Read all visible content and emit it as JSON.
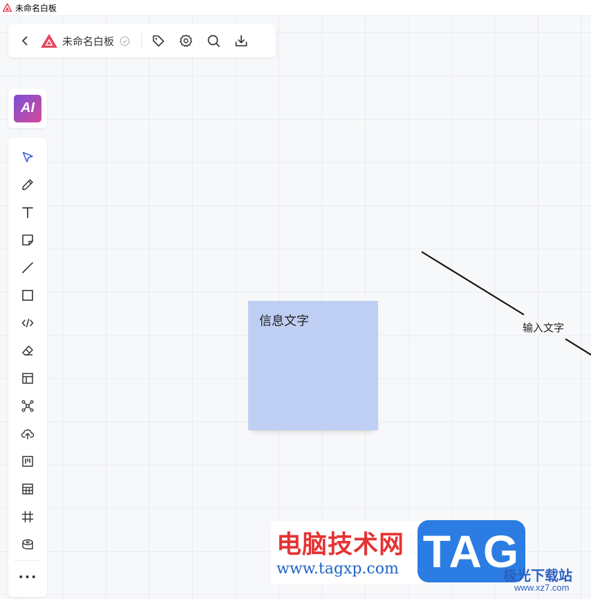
{
  "window": {
    "title": "未命名白板"
  },
  "topbar": {
    "doc_title": "未命名白板",
    "icons": [
      "back-icon",
      "doc-logo-icon",
      "saved-check-icon",
      "tag-icon",
      "gear-icon",
      "search-icon",
      "download-icon"
    ]
  },
  "ai_button": {
    "label": "AI"
  },
  "toolbar": {
    "tools": [
      "select-icon",
      "pencil-icon",
      "text-icon",
      "sticky-note-icon",
      "line-icon",
      "rectangle-icon",
      "code-icon",
      "eraser-icon",
      "layout-icon",
      "mindmap-icon",
      "upload-icon",
      "kanban-icon",
      "table-icon",
      "frame-icon",
      "tape-icon"
    ],
    "more_label": "•••"
  },
  "canvas": {
    "sticky_note": {
      "text": "信息文字",
      "color": "#bfcff4"
    },
    "line_label": "输入文字"
  },
  "watermark": {
    "cn_text": "电脑技术网",
    "url": "www.tagxp.com",
    "tag": "TAG",
    "site_cn": "极光下载站",
    "site_url": "www.xz7.com"
  },
  "colors": {
    "brand_red": "#e8455a",
    "accent_blue": "#3b5bdb",
    "sticky": "#bfcff4"
  }
}
